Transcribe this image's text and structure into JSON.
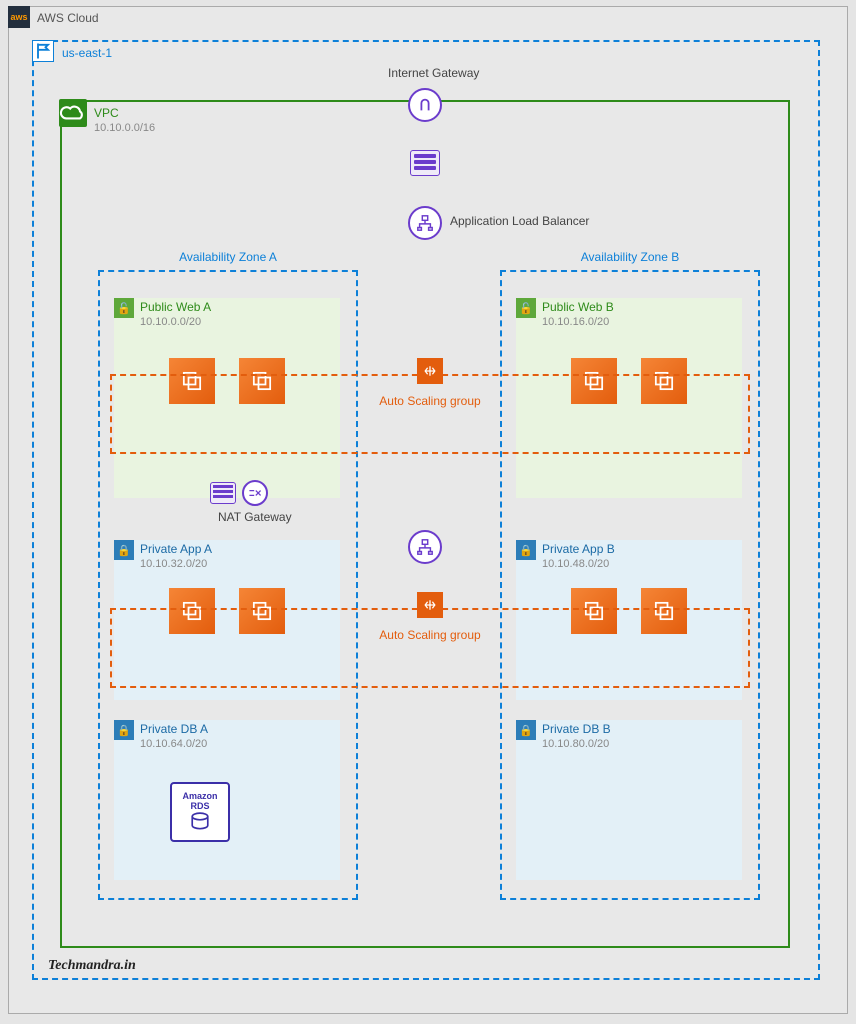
{
  "cloud": {
    "title": "AWS Cloud",
    "badge": "aws"
  },
  "region": {
    "name": "us-east-1"
  },
  "vpc": {
    "name": "VPC",
    "cidr": "10.10.0.0/16"
  },
  "az": {
    "a": "Availability Zone A",
    "b": "Availability Zone B"
  },
  "igw": {
    "label": "Internet Gateway"
  },
  "alb": {
    "label": "Application Load Balancer"
  },
  "nat": {
    "label": "NAT Gateway"
  },
  "asg": {
    "label1": "Auto Scaling group",
    "label2": "Auto Scaling group"
  },
  "rds": {
    "top": "Amazon",
    "bottom": "RDS"
  },
  "subnets": {
    "pubA": {
      "name": "Public Web A",
      "cidr": "10.10.0.0/20"
    },
    "pubB": {
      "name": "Public Web B",
      "cidr": "10.10.16.0/20"
    },
    "appA": {
      "name": "Private App A",
      "cidr": "10.10.32.0/20"
    },
    "appB": {
      "name": "Private App B",
      "cidr": "10.10.48.0/20"
    },
    "dbA": {
      "name": "Private DB A",
      "cidr": "10.10.64.0/20"
    },
    "dbB": {
      "name": "Private DB B",
      "cidr": "10.10.80.0/20"
    }
  },
  "watermark": "Techmandra.in"
}
